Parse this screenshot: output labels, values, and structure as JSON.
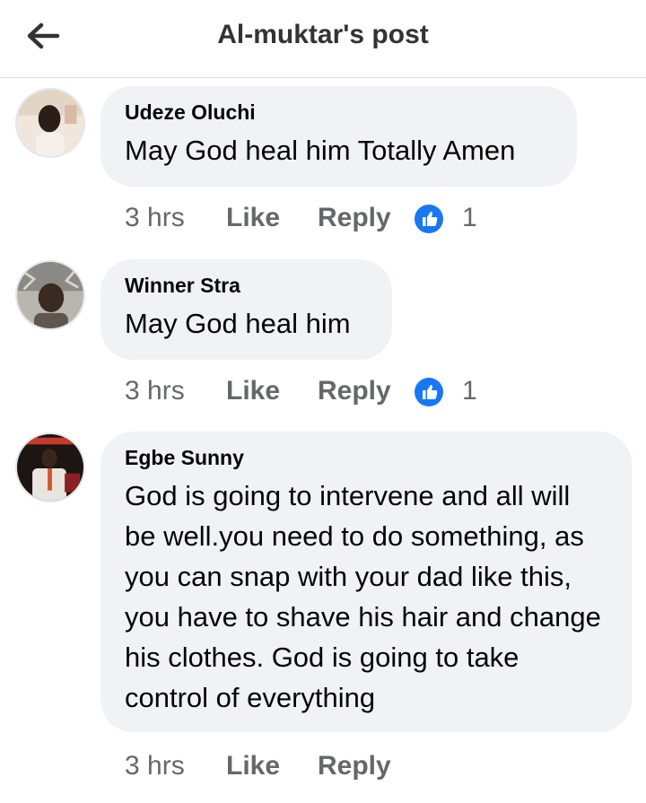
{
  "header": {
    "title": "Al-muktar's post",
    "back_icon": "arrow-left-icon"
  },
  "colors": {
    "bubble": "#f0f2f5",
    "meta_text": "#65676b",
    "like_blue": "#1877f2"
  },
  "comments": [
    {
      "author": "Udeze Oluchi",
      "text": "May God heal him Totally Amen",
      "time": "3 hrs",
      "like_label": "Like",
      "reply_label": "Reply",
      "reaction_count": "1",
      "reaction_icon": "thumbs-up-icon"
    },
    {
      "author": "Winner Stra",
      "text": "May God heal him",
      "time": "3 hrs",
      "like_label": "Like",
      "reply_label": "Reply",
      "reaction_count": "1",
      "reaction_icon": "thumbs-up-icon"
    },
    {
      "author": "Egbe Sunny",
      "text": "God is going to intervene and all will be well.you need to do something, as you can snap with your dad like this, you have to shave his hair and change his clothes. God is going to take control of everything",
      "time": "3 hrs",
      "like_label": "Like",
      "reply_label": "Reply"
    }
  ]
}
